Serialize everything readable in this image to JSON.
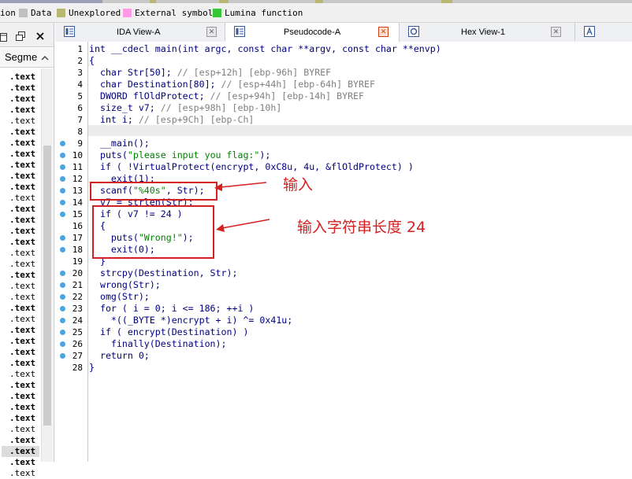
{
  "legend": [
    {
      "label": "ion",
      "color": ""
    },
    {
      "label": "Data",
      "color": "#c0c0c0"
    },
    {
      "label": "Unexplored",
      "color": "#b8b870"
    },
    {
      "label": "External symbol",
      "color": "#ff99e6"
    },
    {
      "label": "Lumina function",
      "color": "#34c834"
    }
  ],
  "left_panel": {
    "header": "Segme",
    "rows": [
      ".text",
      ".text",
      ".text",
      ".text",
      ".text",
      ".text",
      ".text",
      ".text",
      ".text",
      ".text",
      ".text",
      ".text",
      ".text",
      ".text",
      ".text",
      ".text",
      ".text",
      ".text",
      ".text",
      ".text",
      ".text",
      ".text",
      ".text",
      ".text",
      ".text",
      ".text",
      ".text",
      ".text",
      ".text",
      ".text",
      ".text",
      ".text",
      ".text",
      ".text",
      ".text",
      ".text",
      ".text"
    ]
  },
  "tabs": [
    {
      "label": "IDA View-A"
    },
    {
      "label": "Pseudocode-A"
    },
    {
      "label": "Hex View-1"
    },
    {
      "label": ""
    }
  ],
  "code": {
    "line_numbers": [
      "1",
      "2",
      "3",
      "4",
      "5",
      "6",
      "7",
      "8",
      "9",
      "10",
      "11",
      "12",
      "13",
      "14",
      "15",
      "16",
      "17",
      "18",
      "19",
      "20",
      "21",
      "22",
      "23",
      "24",
      "25",
      "26",
      "27",
      "28"
    ],
    "lines": [
      "int __cdecl main(int argc, const char **argv, const char **envp)",
      "{",
      "  char Str[50]; // [esp+12h] [ebp-96h] BYREF",
      "  char Destination[80]; // [esp+44h] [ebp-64h] BYREF",
      "  DWORD flOldProtect; // [esp+94h] [ebp-14h] BYREF",
      "  size_t v7; // [esp+98h] [ebp-10h]",
      "  int i; // [esp+9Ch] [ebp-Ch]",
      "",
      "  __main();",
      "  puts(\"please input you flag:\");",
      "  if ( !VirtualProtect(encrypt, 0xC8u, 4u, &flOldProtect) )",
      "    exit(1);",
      "  scanf(\"%40s\", Str);",
      "  v7 = strlen(Str);",
      "  if ( v7 != 24 )",
      "  {",
      "    puts(\"Wrong!\");",
      "    exit(0);",
      "  }",
      "  strcpy(Destination, Str);",
      "  wrong(Str);",
      "  omg(Str);",
      "  for ( i = 0; i <= 186; ++i )",
      "    *((_BYTE *)encrypt + i) ^= 0x41u;",
      "  if ( encrypt(Destination) )",
      "    finally(Destination);",
      "  return 0;",
      "}"
    ]
  },
  "annotations": {
    "input_label": "输入",
    "length_label": "输入字符串长度 24"
  }
}
